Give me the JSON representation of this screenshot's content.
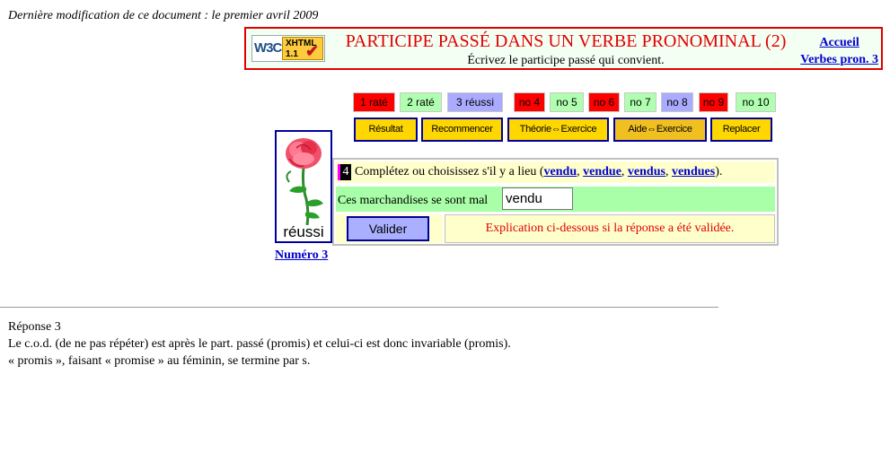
{
  "last_modified": "Dernière modification de ce document : le premier avril 2009",
  "header": {
    "badge": {
      "w3c": "W3C",
      "xhtml": "XHTML",
      "version": "1.1"
    },
    "title": "PARTICIPE PASSÉ DANS UN VERBE PRONOMINAL (2)",
    "subtitle": "Écrivez le participe passé qui convient.",
    "links": {
      "accueil": "Accueil",
      "verbes": "Verbes pron. 3"
    }
  },
  "status": [
    {
      "label": "1 raté",
      "state": "red"
    },
    {
      "label": "2 raté",
      "state": "green"
    },
    {
      "label": "3 réussi",
      "state": "blue"
    },
    {
      "label": "no 4",
      "state": "red"
    },
    {
      "label": "no 5",
      "state": "green"
    },
    {
      "label": "no 6",
      "state": "red"
    },
    {
      "label": "no 7",
      "state": "green"
    },
    {
      "label": "no 8",
      "state": "blue"
    },
    {
      "label": "no 9",
      "state": "red"
    },
    {
      "label": "no 10",
      "state": "green"
    }
  ],
  "buttons": {
    "resultat": "Résultat",
    "recommencer": "Recommencer",
    "theorie": "Théorie⇔Exercice",
    "aide": "Aide⇔Exercice",
    "replacer": "Replacer"
  },
  "rose": {
    "label": "réussi",
    "link": "Numéro 3"
  },
  "exercise": {
    "number": "4",
    "instruction_prefix": "Complétez ou choisissez s'il y a lieu (",
    "options": [
      "vendu",
      "vendue",
      "vendus",
      "vendues"
    ],
    "sep": ", ",
    "instruction_suffix": ").",
    "sentence": "Ces marchandises se sont mal",
    "answer_value": "vendu",
    "valider": "Valider",
    "explanation": "Explication ci-dessous si la réponse a été validée."
  },
  "answer": {
    "title": "Réponse 3",
    "line1": "Le c.o.d. (de ne pas répéter) est après le part. passé (promis) et celui-ci est donc invariable (promis).",
    "line2": "« promis », faisant « promise » au féminin, se termine par s."
  },
  "colors": {
    "red": "#ff0000",
    "green": "#b0ffb0",
    "blue": "#aaaaff",
    "yellow": "#ffd700",
    "border_blue": "#0000a0"
  }
}
